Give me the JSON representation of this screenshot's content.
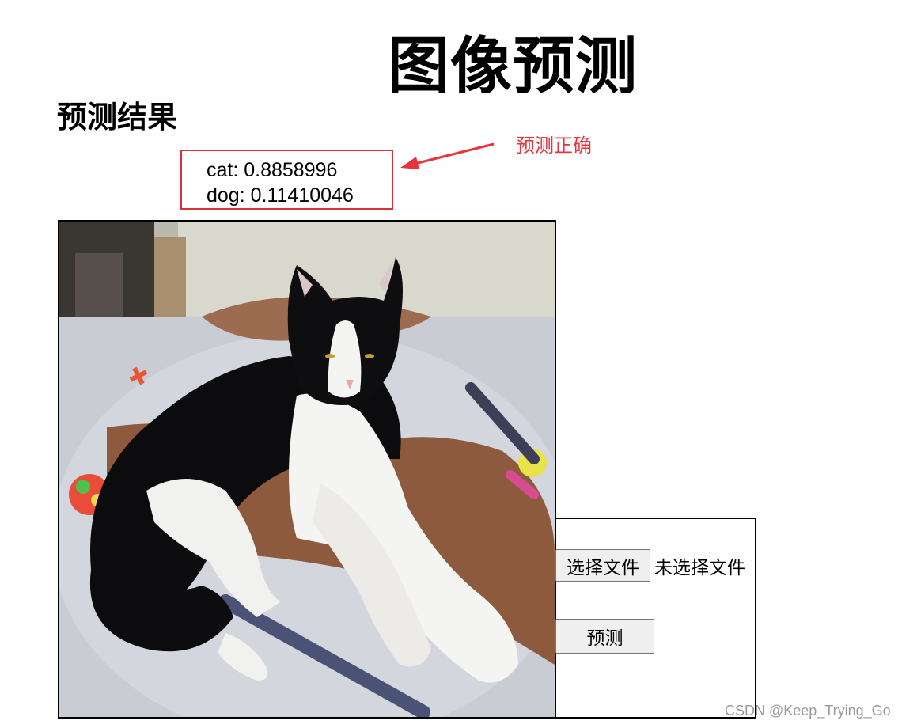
{
  "page": {
    "title": "图像预测",
    "result_heading": "预测结果"
  },
  "results": [
    {
      "text": "cat: 0.8858996"
    },
    {
      "text": "dog: 0.11410046"
    }
  ],
  "annotation": {
    "label": "预测正确",
    "color": "#e8323c",
    "box_color": "#d9303a"
  },
  "image": {
    "description_icon": "cat-photo"
  },
  "upload": {
    "choose_button": "选择文件",
    "status": "未选择文件",
    "predict_button": "预测"
  },
  "watermark": "CSDN @Keep_Trying_Go"
}
